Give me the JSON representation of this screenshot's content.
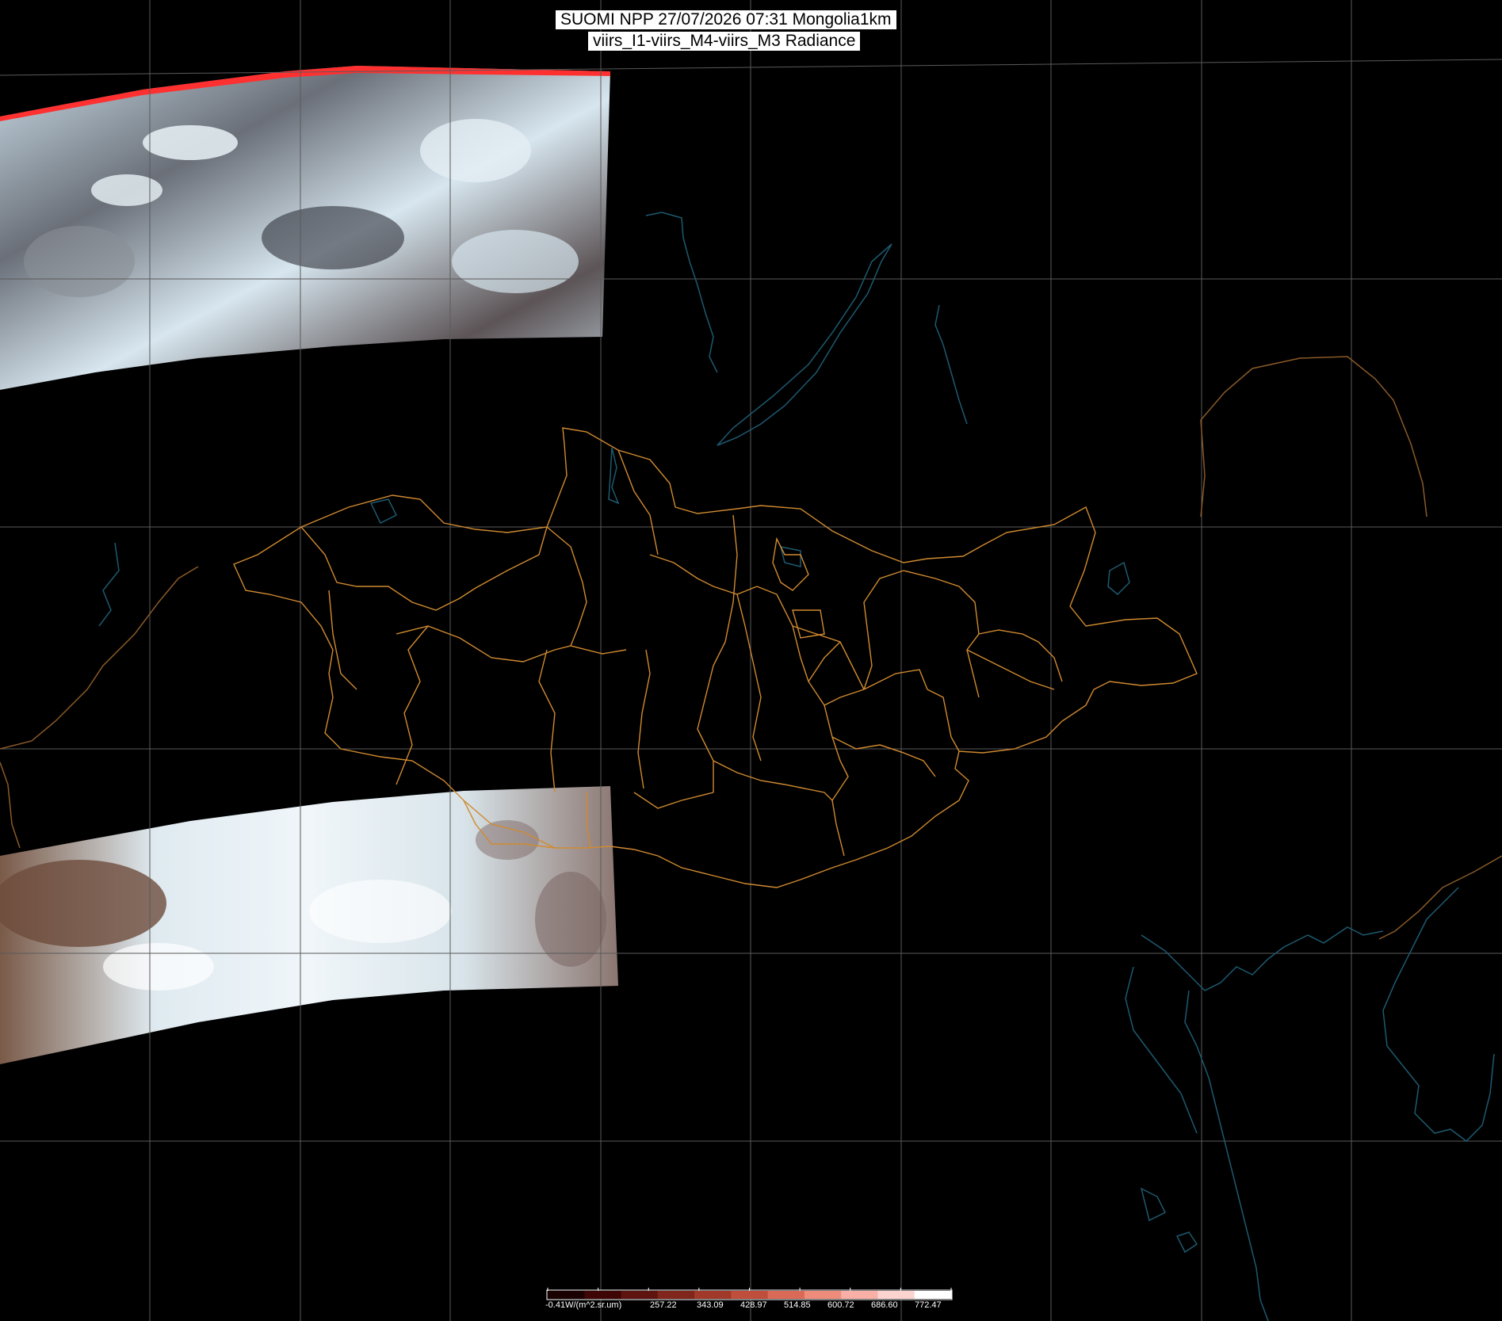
{
  "header": {
    "line1": "SUOMI NPP 27/07/2026 07:31 Mongolia1km",
    "line2": "viirs_I1-viirs_M4-viirs_M3 Radiance"
  },
  "colorbar": {
    "unit_label": "-0.41W/(m^2.sr.um)",
    "ticks": [
      "257.22",
      "343.09",
      "428.97",
      "514.85",
      "600.72",
      "686.60",
      "772.47"
    ],
    "colors": [
      "#1a0000",
      "#3d0604",
      "#5e1510",
      "#80261c",
      "#a1392a",
      "#c04e3c",
      "#da6a58",
      "#ee8c7c",
      "#f8b0a6",
      "#fcd4cf",
      "#ffffff"
    ]
  },
  "map_colors": {
    "background": "#000000",
    "graticule": "#5a5a5a",
    "coastline": "#1d5a70",
    "province_border": "#d08a30",
    "country_border": "#8a5a28"
  }
}
